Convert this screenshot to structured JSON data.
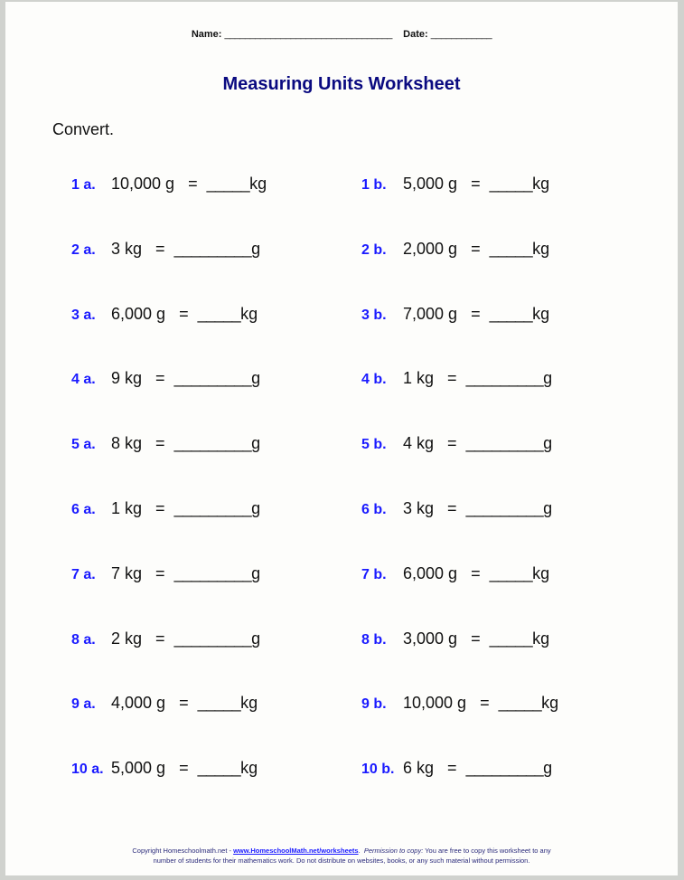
{
  "header": {
    "name_label": "Name:",
    "name_blank": "_________________________________",
    "date_label": "Date:",
    "date_blank": "____________"
  },
  "title": "Measuring Units Worksheet",
  "instructions": "Convert.",
  "colors": {
    "title": "#0a0a80",
    "problem_number": "#1a1aff",
    "page": "#fdfdfb",
    "frame": "#d0d2ce"
  },
  "problems": {
    "left": [
      {
        "num": "1 a.",
        "given": "10,000 g",
        "equals": "=",
        "blank": "_____",
        "unit": "kg"
      },
      {
        "num": "2 a.",
        "given": "3 kg",
        "equals": "=",
        "blank": "_________",
        "unit": "g"
      },
      {
        "num": "3 a.",
        "given": "6,000 g",
        "equals": "=",
        "blank": "_____",
        "unit": "kg"
      },
      {
        "num": "4 a.",
        "given": "9 kg",
        "equals": "=",
        "blank": "_________",
        "unit": "g"
      },
      {
        "num": "5 a.",
        "given": "8 kg",
        "equals": "=",
        "blank": "_________",
        "unit": "g"
      },
      {
        "num": "6 a.",
        "given": "1 kg",
        "equals": "=",
        "blank": "_________",
        "unit": "g"
      },
      {
        "num": "7 a.",
        "given": "7 kg",
        "equals": "=",
        "blank": "_________",
        "unit": "g"
      },
      {
        "num": "8 a.",
        "given": "2 kg",
        "equals": "=",
        "blank": "_________",
        "unit": "g"
      },
      {
        "num": "9 a.",
        "given": "4,000 g",
        "equals": "=",
        "blank": "_____",
        "unit": "kg"
      },
      {
        "num": "10 a.",
        "given": "5,000 g",
        "equals": "=",
        "blank": "_____",
        "unit": "kg"
      }
    ],
    "right": [
      {
        "num": "1 b.",
        "given": "5,000 g",
        "equals": "=",
        "blank": "_____",
        "unit": "kg"
      },
      {
        "num": "2 b.",
        "given": "2,000 g",
        "equals": "=",
        "blank": "_____",
        "unit": "kg"
      },
      {
        "num": "3 b.",
        "given": "7,000 g",
        "equals": "=",
        "blank": "_____",
        "unit": "kg"
      },
      {
        "num": "4 b.",
        "given": "1 kg",
        "equals": "=",
        "blank": "_________",
        "unit": "g"
      },
      {
        "num": "5 b.",
        "given": "4 kg",
        "equals": "=",
        "blank": "_________",
        "unit": "g"
      },
      {
        "num": "6 b.",
        "given": "3 kg",
        "equals": "=",
        "blank": "_________",
        "unit": "g"
      },
      {
        "num": "7 b.",
        "given": "6,000 g",
        "equals": "=",
        "blank": "_____",
        "unit": "kg"
      },
      {
        "num": "8 b.",
        "given": "3,000 g",
        "equals": "=",
        "blank": "_____",
        "unit": "kg"
      },
      {
        "num": "9 b.",
        "given": "10,000 g",
        "equals": "=",
        "blank": "_____",
        "unit": "kg"
      },
      {
        "num": "10 b.",
        "given": "6 kg",
        "equals": "=",
        "blank": "_________",
        "unit": "g"
      }
    ]
  },
  "footer": {
    "copyright": "Copyright Homeschoolmath.net - ",
    "link": "www.HomeschoolMath.net/worksheets",
    "permission_label": "Permission to copy:",
    "line1_rest": " You are free to copy this worksheet to any",
    "line2": "number of students for their mathematics work. Do not distribute on websites, books, or any such material without permission."
  }
}
